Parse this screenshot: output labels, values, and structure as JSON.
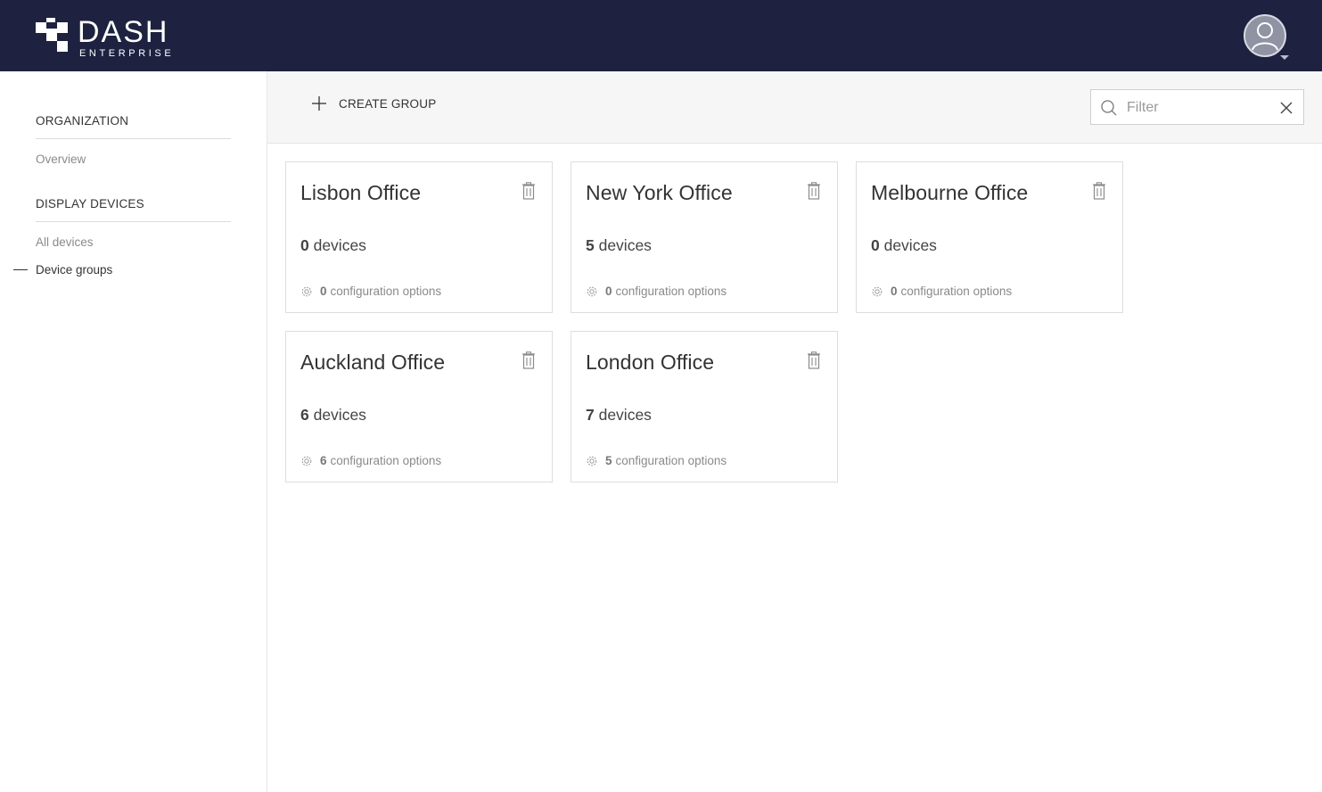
{
  "app": {
    "logo_title": "DASH",
    "logo_subtitle": "ENTERPRISE"
  },
  "sidebar": {
    "sections": [
      {
        "title": "ORGANIZATION",
        "items": [
          {
            "label": "Overview",
            "active": false
          }
        ]
      },
      {
        "title": "DISPLAY DEVICES",
        "items": [
          {
            "label": "All devices",
            "active": false
          },
          {
            "label": "Device groups",
            "active": true
          }
        ]
      }
    ]
  },
  "toolbar": {
    "create_label": "CREATE GROUP",
    "filter_placeholder": "Filter",
    "filter_value": ""
  },
  "groups": [
    {
      "name": "Lisbon Office",
      "devices": "0",
      "devices_unit": " devices",
      "config": "0",
      "config_unit": "configuration options"
    },
    {
      "name": "New York Office",
      "devices": "5",
      "devices_unit": " devices",
      "config": "0",
      "config_unit": "configuration options"
    },
    {
      "name": "Melbourne Office",
      "devices": "0",
      "devices_unit": " devices",
      "config": "0",
      "config_unit": "configuration options"
    },
    {
      "name": "Auckland Office",
      "devices": "6",
      "devices_unit": " devices",
      "config": "6",
      "config_unit": "configuration options"
    },
    {
      "name": "London Office",
      "devices": "7",
      "devices_unit": " devices",
      "config": "5",
      "config_unit": "configuration options"
    }
  ],
  "colors": {
    "header_bg": "#1e2240",
    "toolbar_bg": "#f6f6f6"
  }
}
